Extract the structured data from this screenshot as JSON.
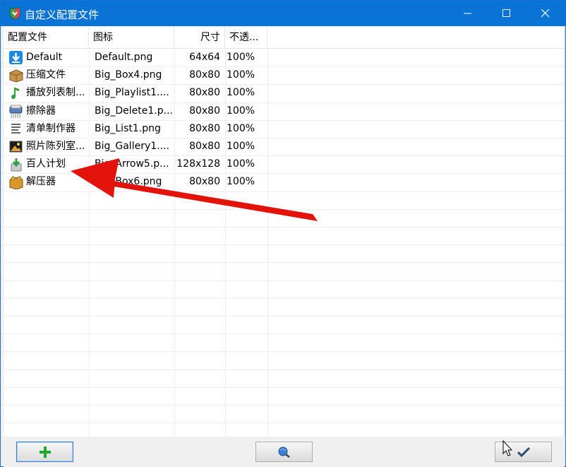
{
  "window": {
    "title": "自定义配置文件"
  },
  "titlebar_buttons": {
    "minimize": "minimize-icon",
    "maximize": "maximize-icon",
    "close": "close-icon"
  },
  "list": {
    "columns": [
      "配置文件",
      "图标",
      "尺寸",
      "不透..."
    ],
    "rows": [
      {
        "icon": "download-arrow-icon",
        "name": "Default",
        "file": "Default.png",
        "size": "64x64",
        "opacity": "100%"
      },
      {
        "icon": "box-icon",
        "name": "压缩文件",
        "file": "Big_Box4.png",
        "size": "80x80",
        "opacity": "100%"
      },
      {
        "icon": "music-note-icon",
        "name": "播放列表制...",
        "file": "Big_Playlist1....",
        "size": "80x80",
        "opacity": "100%"
      },
      {
        "icon": "shredder-icon",
        "name": "擦除器",
        "file": "Big_Delete1.p...",
        "size": "80x80",
        "opacity": "100%"
      },
      {
        "icon": "list-icon",
        "name": "清单制作器",
        "file": "Big_List1.png",
        "size": "80x80",
        "opacity": "100%"
      },
      {
        "icon": "picture-icon",
        "name": "照片陈列室...",
        "file": "Big_Gallery1....",
        "size": "80x80",
        "opacity": "100%"
      },
      {
        "icon": "down-arrow-box-icon",
        "name": "百人计划",
        "file": "Big_Arrow5.p...",
        "size": "128x128",
        "opacity": "100%"
      },
      {
        "icon": "open-box-icon",
        "name": "解压器",
        "file": "Big_Box6.png",
        "size": "80x80",
        "opacity": "100%"
      }
    ]
  },
  "bottom_buttons": {
    "add": "plus-icon",
    "preview": "globe-magnifier-icon",
    "ok": "checkmark-icon"
  },
  "colors": {
    "titlebar": "#0a73d6",
    "arrow": "#e3120b"
  }
}
